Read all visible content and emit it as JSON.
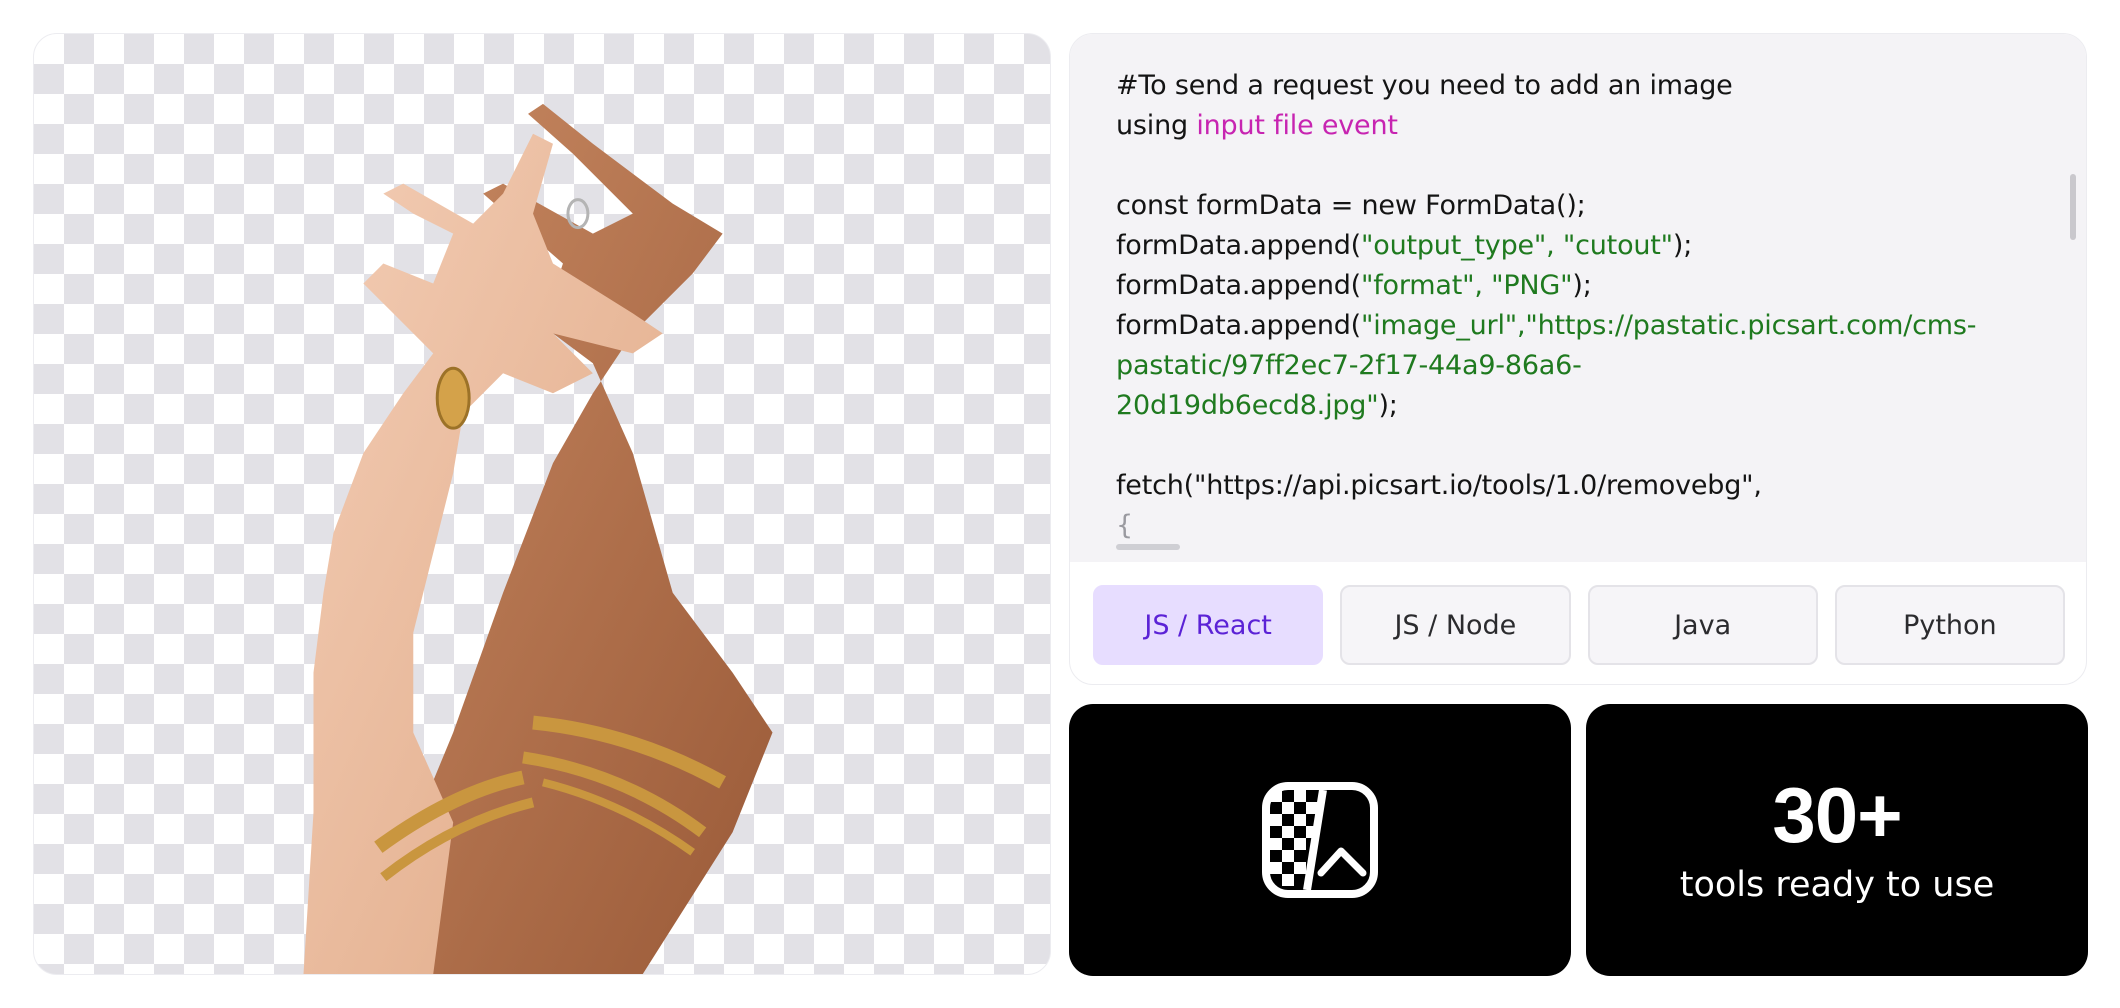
{
  "code": {
    "lines": [
      [
        {
          "t": "#To send a request you need to add an image",
          "c": "plain"
        }
      ],
      [
        {
          "t": "using ",
          "c": "plain"
        },
        {
          "t": "input file event",
          "c": "link"
        }
      ],
      [
        {
          "t": "",
          "c": "plain"
        }
      ],
      [
        {
          "t": "const formData = new FormData();",
          "c": "plain"
        }
      ],
      [
        {
          "t": "formData.append(",
          "c": "plain"
        },
        {
          "t": "\"output_type\", \"cutout\"",
          "c": "str"
        },
        {
          "t": ");",
          "c": "plain"
        }
      ],
      [
        {
          "t": "formData.append(",
          "c": "plain"
        },
        {
          "t": "\"format\", \"PNG\"",
          "c": "str"
        },
        {
          "t": ");",
          "c": "plain"
        }
      ],
      [
        {
          "t": "formData.append(",
          "c": "plain"
        },
        {
          "t": "\"image_url\",\"https://pastatic.picsart.com/cms-",
          "c": "str"
        }
      ],
      [
        {
          "t": "pastatic/97ff2ec7-2f17-44a9-86a6-",
          "c": "str"
        }
      ],
      [
        {
          "t": "20d19db6ecd8.jpg\"",
          "c": "str"
        },
        {
          "t": ");",
          "c": "plain"
        }
      ],
      [
        {
          "t": "",
          "c": "plain"
        }
      ],
      [
        {
          "t": "fetch(\"https://api.picsart.io/tools/1.0/removebg\",",
          "c": "plain"
        }
      ],
      [
        {
          "t": "{",
          "c": "dim"
        }
      ]
    ]
  },
  "tabs": [
    {
      "label": "JS / React",
      "active": true
    },
    {
      "label": "JS / Node",
      "active": false
    },
    {
      "label": "Java",
      "active": false
    },
    {
      "label": "Python",
      "active": false
    }
  ],
  "tool_card": {
    "icon": "background-remover-icon"
  },
  "stat_card": {
    "number": "30+",
    "caption": "tools ready to use"
  },
  "colors": {
    "active_tab_bg": "#e7ddff",
    "active_tab_text": "#5b22d6",
    "code_string": "#1f7a1f",
    "code_link": "#c724b1",
    "card_bg": "#000000"
  }
}
